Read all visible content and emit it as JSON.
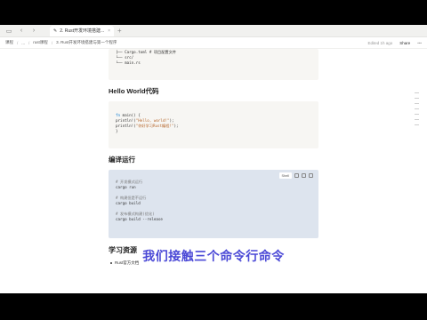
{
  "titlebar": {
    "tab_title": "2. Rust开发环境搭建..."
  },
  "breadcrumb": {
    "items": [
      "课程",
      "...",
      "rust课程",
      "3. Rust开发环境搭建与第一个程序"
    ],
    "edited": "Edited 1h ago",
    "share": "Share"
  },
  "code_tree": {
    "lines": [
      "├── Cargo.toml    # 项目配置文件",
      "└── src/",
      "    └── main.rs"
    ]
  },
  "hello_section": {
    "heading": "Hello World代码",
    "lines": [
      {
        "kw": "fn",
        "rest": " main() {"
      },
      {
        "kw": "",
        "rest": "    println!(",
        "str": "\"Hello, world!\"",
        "tail": ");"
      },
      {
        "kw": "",
        "rest": "    println!(",
        "str": "\"你好学习Rust编程!\"",
        "tail": ");"
      },
      {
        "kw": "",
        "rest": "}"
      }
    ]
  },
  "compile_section": {
    "heading": "编译运行",
    "language": "Shell",
    "lines": [
      {
        "type": "cmt",
        "text": "# 开发模式运行"
      },
      {
        "type": "cmd",
        "text": "cargo run"
      },
      {
        "type": "gap",
        "text": ""
      },
      {
        "type": "cmt",
        "text": "# 构建但是不运行"
      },
      {
        "type": "cmd",
        "text": "cargo build"
      },
      {
        "type": "gap",
        "text": ""
      },
      {
        "type": "cmt",
        "text": "# 发布模式构建(优化)"
      },
      {
        "type": "cmd",
        "text": "cargo build --release"
      }
    ]
  },
  "resources_section": {
    "heading": "学习资源",
    "items": [
      "Rust官方文档"
    ]
  },
  "subtitle": "我们接触三个命令行命令",
  "colors": {
    "subtitle": "#4a48d6",
    "code_bg": "#f7f6f3",
    "code_highlight_bg": "#dde4ee"
  }
}
